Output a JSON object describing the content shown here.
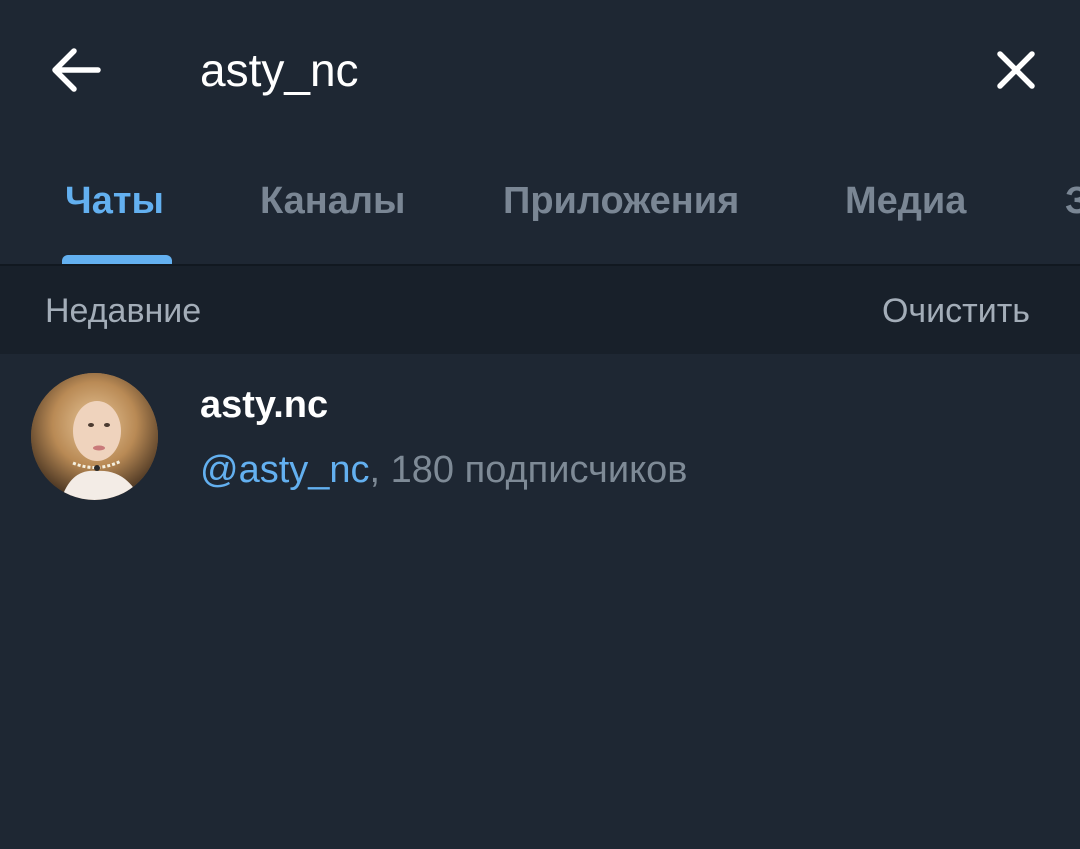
{
  "search": {
    "query": "asty_nc"
  },
  "tabs": [
    {
      "label": "Чаты",
      "active": true
    },
    {
      "label": "Каналы",
      "active": false
    },
    {
      "label": "Приложения",
      "active": false
    },
    {
      "label": "Медиа",
      "active": false
    },
    {
      "label": "З",
      "active": false
    }
  ],
  "recent": {
    "title": "Недавние",
    "clear_label": "Очистить"
  },
  "results": [
    {
      "name": "asty.nc",
      "handle": "@asty_nc",
      "details": ", 180 подписчиков"
    }
  ],
  "colors": {
    "background": "#1e2733",
    "accent": "#63b0f0",
    "muted_text": "#7a8694",
    "header_bg": "#18202a"
  },
  "icons": {
    "back": "arrow-left-icon",
    "close": "close-icon"
  }
}
